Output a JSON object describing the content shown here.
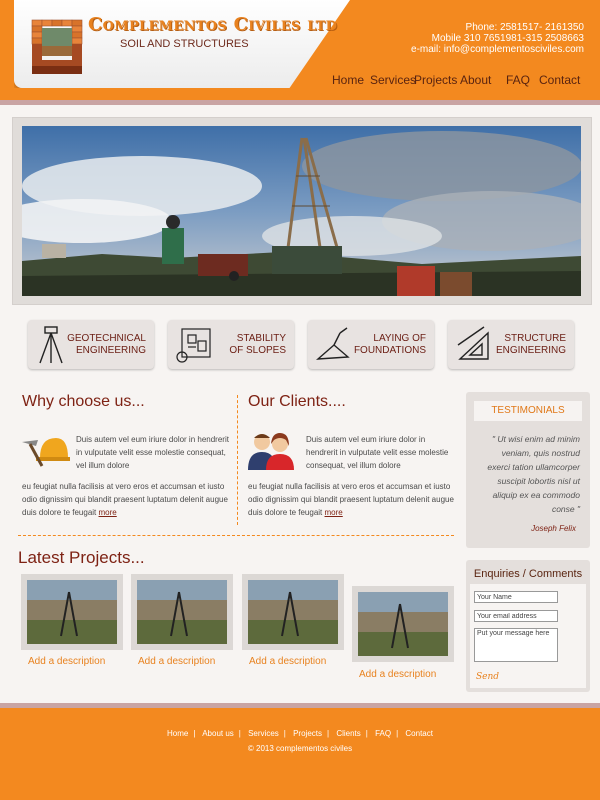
{
  "header": {
    "title": "Complementos Civiles ltd",
    "subtitle": "SOIL AND STRUCTURES",
    "phone": "Phone: 2581517- 2161350",
    "mobile": "Mobile 310 7651981-315 2508663",
    "email": "e-mail: info@complementosciviles.com"
  },
  "nav": [
    "Home",
    "Services",
    "Projects",
    "About",
    "FAQ",
    "Contact"
  ],
  "services": [
    {
      "line1": "GEOTECHNICAL",
      "line2": "ENGINEERING",
      "icon": "tripod-icon"
    },
    {
      "line1": "STABILITY",
      "line2": "OF SLOPES",
      "icon": "blueprint-icon"
    },
    {
      "line1": "LAYING OF",
      "line2": "FOUNDATIONS",
      "icon": "trowel-icon"
    },
    {
      "line1": "STRUCTURE",
      "line2": "ENGINEERING",
      "icon": "set-square-icon"
    }
  ],
  "why": {
    "title": "Why choose us...",
    "para1": "Duis autem vel eum iriure dolor in hendrerit in vulputate velit esse molestie consequat, vel illum dolore",
    "para2": "eu feugiat nulla facilisis at vero eros et accumsan et iusto odio dignissim qui blandit praesent luptatum delenit augue duis dolore te feugait",
    "more": "more"
  },
  "clients": {
    "title": "Our Clients....",
    "para1": "Duis autem vel eum iriure dolor in hendrerit in vulputate velit esse molestie consequat, vel illum dolore",
    "para2": "eu feugiat nulla facilisis at vero eros et accumsan et iusto odio dignissim qui blandit praesent luptatum delenit augue duis dolore te feugait",
    "more": "more"
  },
  "testimonial": {
    "heading": "TESTIMONIALS",
    "quote": "\" Ut wisi enim ad minim veniam, quis nostrud exerci tation ullamcorper suscipit lobortis nisl ut aliquip ex ea commodo conse \"",
    "author": "Joseph Felix"
  },
  "latest": {
    "title": "Latest Projects...",
    "captions": [
      "Add a description",
      "Add a description",
      "Add a description",
      "Add a description"
    ]
  },
  "enquiry": {
    "title": "Enquiries / Comments",
    "name_value": "Your Name",
    "email_value": "Your email address",
    "message_value": "Put your message here",
    "send": "Send"
  },
  "footer": {
    "links": [
      "Home",
      "About us",
      "Services",
      "Projects",
      "Clients",
      "FAQ",
      "Contact"
    ],
    "copyright": "© 2013 complementos civiles"
  },
  "colors": {
    "accent": "#f3891f",
    "brand_dark": "#7e2214",
    "band": "#c9a4a3"
  }
}
